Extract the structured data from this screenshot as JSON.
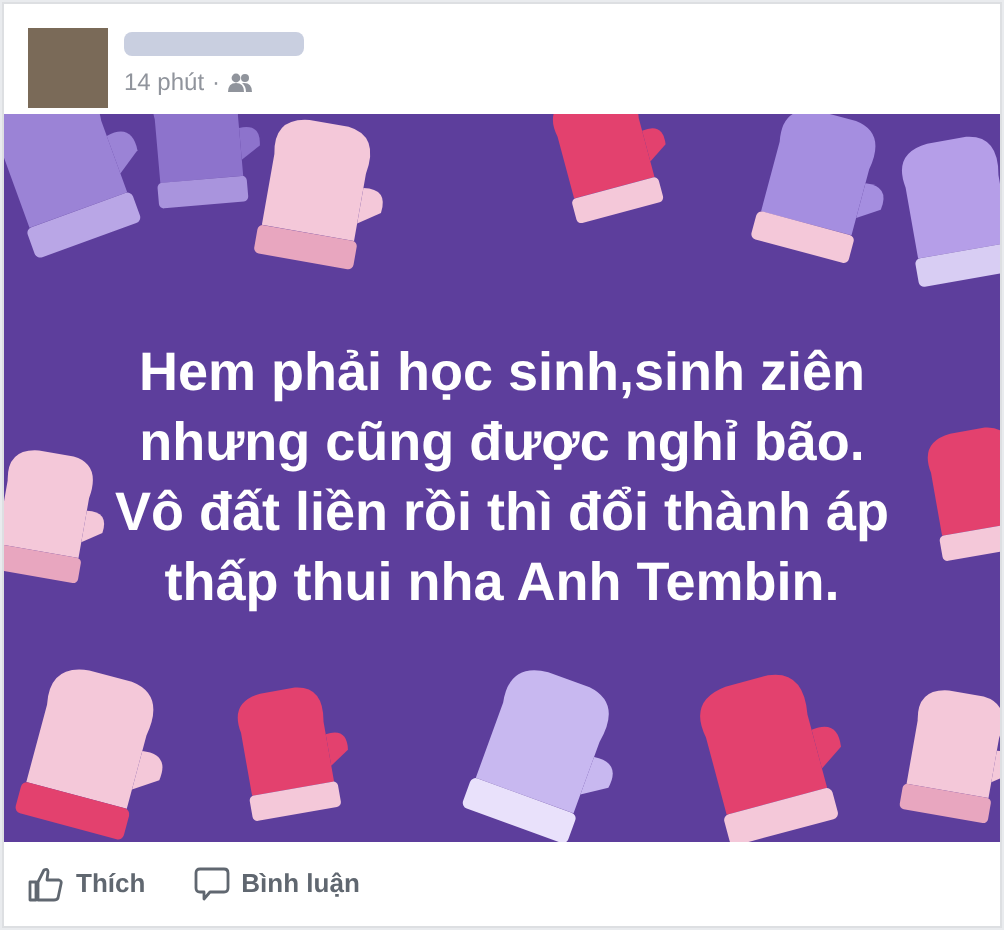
{
  "post": {
    "time": "14 phút",
    "separator": "·",
    "friends_only": true,
    "text_lines": [
      "Hem phải học sinh,sinh ziên",
      "nhưng cũng được nghỉ bão.",
      "Vô đất liền rồi thì đổi thành áp",
      "thấp thui nha Anh Tembin."
    ]
  },
  "actions": [
    {
      "kind": "like",
      "label": "Thích"
    },
    {
      "kind": "comment",
      "label": "Bình luận"
    }
  ]
}
